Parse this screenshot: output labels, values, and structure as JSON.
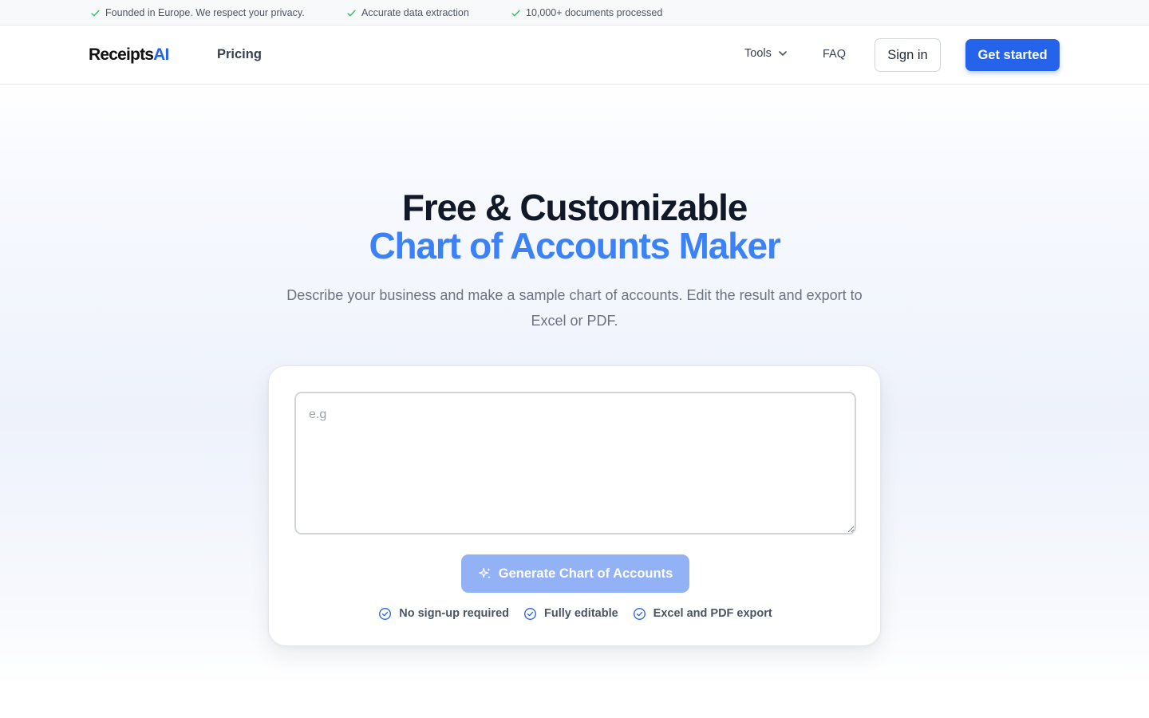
{
  "topbar": {
    "items": [
      {
        "icon": "check-icon",
        "text": "Founded in Europe. We respect your privacy."
      },
      {
        "icon": "check-icon",
        "text": "Accurate data extraction"
      },
      {
        "icon": "check-icon",
        "text": "10,000+ documents processed"
      }
    ]
  },
  "header": {
    "logo_main": "Receipts",
    "logo_accent": "AI",
    "nav": {
      "pricing": "Pricing",
      "tools": "Tools",
      "faq": "FAQ"
    },
    "sign_in": "Sign in",
    "get_started": "Get started"
  },
  "hero": {
    "title_line1": "Free & Customizable",
    "title_line2": "Chart of Accounts Maker",
    "subtitle": "Describe your business and make a sample chart of accounts. Edit the result and export to Excel or PDF."
  },
  "form": {
    "placeholder": "e.g",
    "value": "",
    "generate_button": "Generate Chart of Accounts",
    "features": [
      "No sign-up required",
      "Fully editable",
      "Excel and PDF export"
    ]
  },
  "colors": {
    "accent": "#2563eb",
    "accent_light": "#3b82f6",
    "check_green": "#22c55e",
    "button_disabled": "#93b2f5"
  }
}
